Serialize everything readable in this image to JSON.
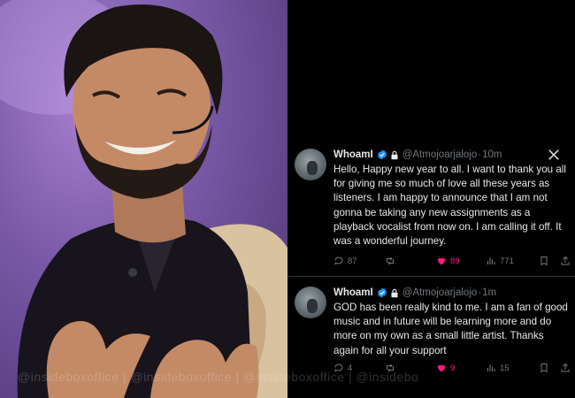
{
  "tweets": [
    {
      "name": "WhoamI",
      "handle": "@Atmojoarjalojo",
      "time": "10m",
      "text": "Hello, Happy new year to all. I want to thank you all for giving me so much of love all these years as listeners. I am happy to announce that I am not gonna be taking any new assignments as a playback vocalist from now on. I am calling it off. It was a wonderful journey.",
      "replies": "87",
      "retweets": "",
      "likes": "89",
      "views": "771"
    },
    {
      "name": "WhoamI",
      "handle": "@Atmojoarjalojo",
      "time": "1m",
      "text": "GOD has been really kind to me. I am a fan of good music and in future will be learning more and do more on my own as a small little artist. Thanks again for all your support",
      "replies": "4",
      "retweets": "",
      "likes": "9",
      "views": "15"
    }
  ],
  "watermark": "@insideboxoffice | @insideboxoffice | @insideboxoffice | @insidebo",
  "colors": {
    "like": "#f91880",
    "verified": "#1d9bf0",
    "muted": "#71767b",
    "text": "#e7e9ea",
    "background": "#000000"
  },
  "icons": [
    "verified-badge-icon",
    "lock-icon",
    "x-logo-icon",
    "reply-icon",
    "retweet-icon",
    "heart-icon",
    "views-icon",
    "bookmark-icon",
    "share-icon"
  ]
}
